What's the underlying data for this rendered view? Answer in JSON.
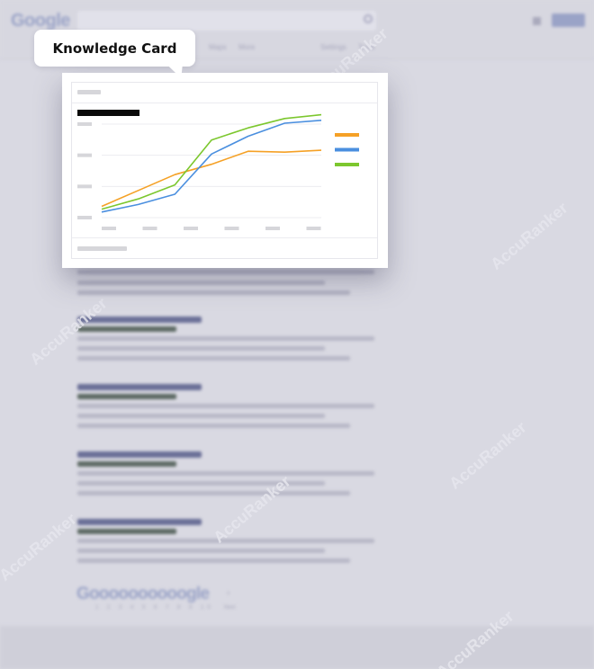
{
  "serp": {
    "logo_text": "Google",
    "pager_logo_text": "Goooooooooogle",
    "pager_numbers": "1 2 3 4 5 6 7 8 9 10",
    "pager_next": "Next",
    "pager_arrow": "›",
    "tabs": [
      {
        "label": "Maps"
      },
      {
        "label": "More"
      },
      {
        "label": "Settings"
      },
      {
        "label": "Tools"
      }
    ]
  },
  "watermark": {
    "text": "AccuRanker"
  },
  "callout": {
    "label": "Knowledge Card"
  },
  "icons": {
    "search": "search-icon",
    "apps": "apps-grid-icon"
  },
  "colors": {
    "background": "#d9d9e2",
    "orange": "#f5a126",
    "blue": "#4a8fdf",
    "green": "#7cc72e"
  },
  "chart_data": {
    "type": "line",
    "title": "",
    "xlabel": "",
    "ylabel": "",
    "x": [
      0,
      1,
      2,
      3,
      4,
      5,
      6
    ],
    "ylim": [
      0,
      100
    ],
    "series": [
      {
        "color": "#f5a126",
        "values": [
          12,
          29,
          46,
          57,
          71,
          70,
          72
        ]
      },
      {
        "color": "#4a8fdf",
        "values": [
          6,
          14,
          25,
          68,
          87,
          101,
          104
        ]
      },
      {
        "color": "#7cc72e",
        "values": [
          9,
          20,
          35,
          83,
          96,
          106,
          110
        ]
      }
    ],
    "grid": true,
    "legend": "right"
  }
}
